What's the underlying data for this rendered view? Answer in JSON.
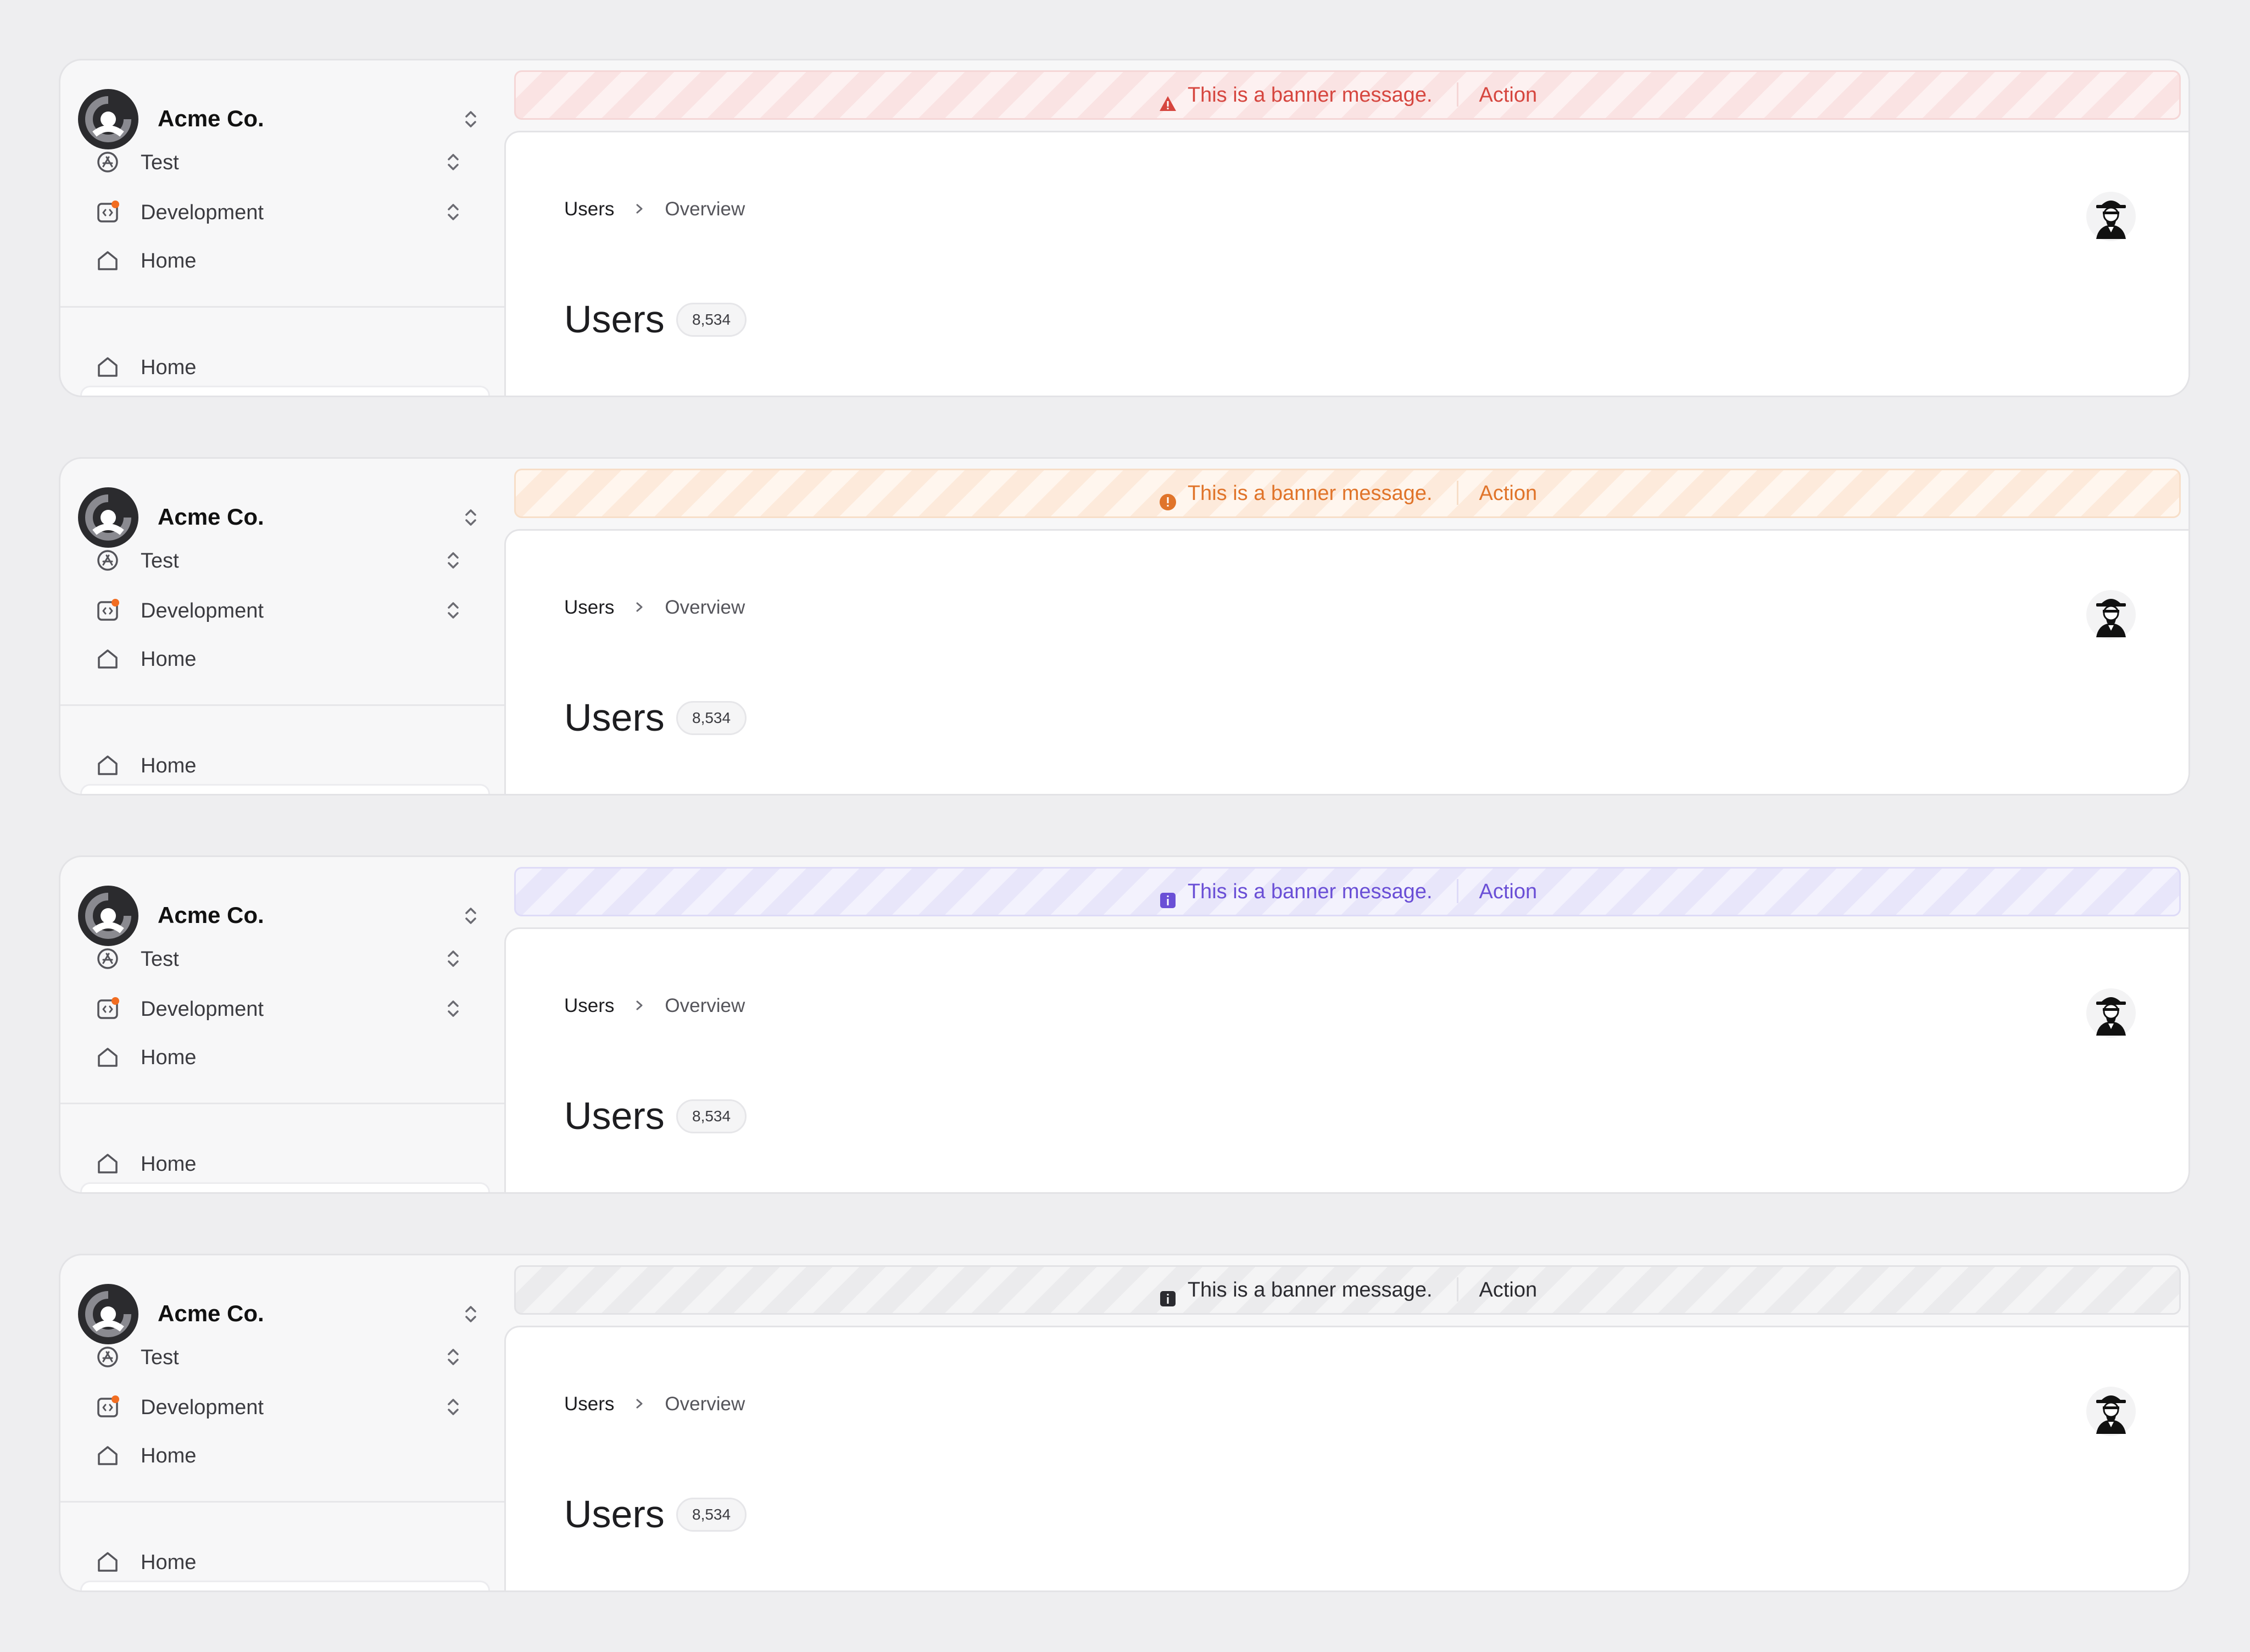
{
  "organization": {
    "name": "Acme Co."
  },
  "sidebar": {
    "items": [
      {
        "label": "Test",
        "icon": "app-store-icon"
      },
      {
        "label": "Development",
        "icon": "code-icon"
      }
    ],
    "nav": [
      {
        "label": "Home",
        "icon": "home-icon"
      }
    ]
  },
  "breadcrumb": {
    "parent": "Users",
    "current": "Overview"
  },
  "page": {
    "title": "Users",
    "count": "8,534"
  },
  "banners": [
    {
      "variant": "error",
      "message": "This is a banner message.",
      "action": "Action",
      "icon": "warning-triangle-icon",
      "text_color": "#d6463f",
      "bg_color": "#fdf1f1",
      "border_color": "#f5d6d6",
      "stripe_color": "#fae3e3"
    },
    {
      "variant": "warning",
      "message": "This is a banner message.",
      "action": "Action",
      "icon": "alert-circle-icon",
      "text_color": "#e0742a",
      "bg_color": "#fff6ee",
      "border_color": "#f7dec8",
      "stripe_color": "#fdeadb"
    },
    {
      "variant": "info",
      "message": "This is a banner message.",
      "action": "Action",
      "icon": "info-square-icon",
      "text_color": "#6a4fd6",
      "bg_color": "#f3f2fd",
      "border_color": "#dedbf7",
      "stripe_color": "#e8e6fa"
    },
    {
      "variant": "neutral",
      "message": "This is a banner message.",
      "action": "Action",
      "icon": "info-square-icon",
      "text_color": "#2b2b30",
      "bg_color": "#f4f4f5",
      "border_color": "#e2e2e5",
      "stripe_color": "#ebebed"
    }
  ]
}
